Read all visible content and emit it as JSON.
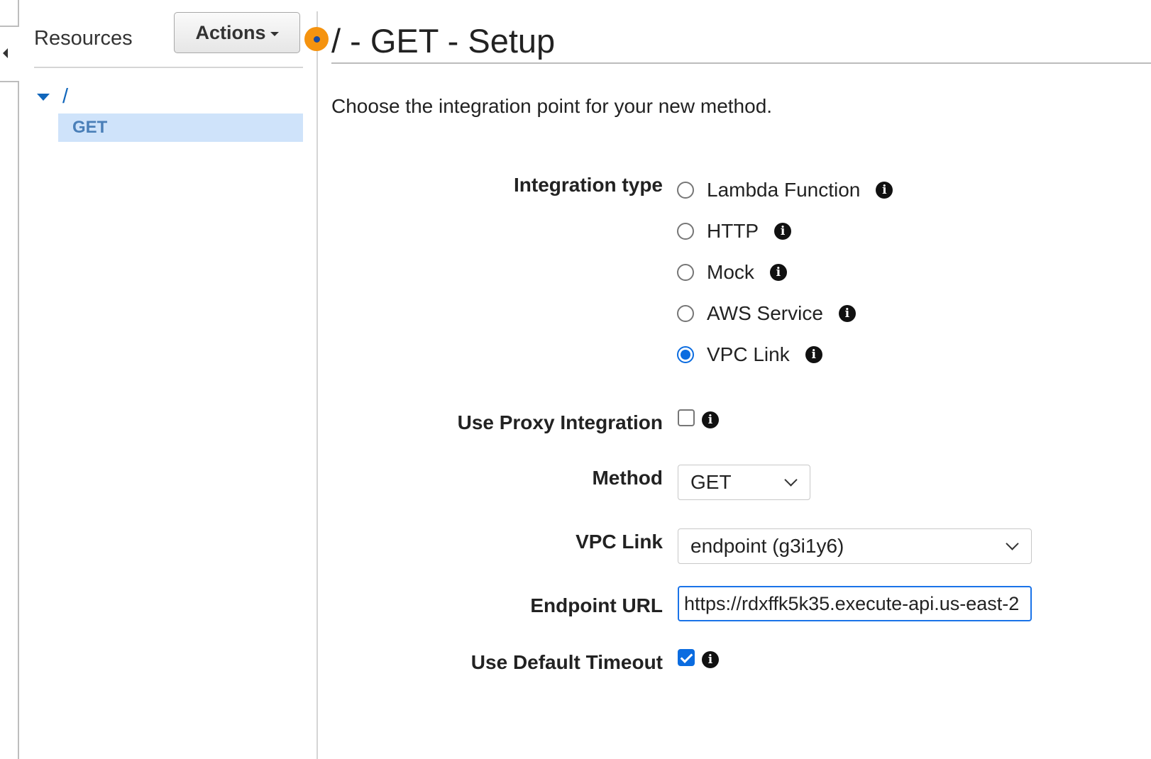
{
  "sidebar": {
    "title": "Resources",
    "actions_label": "Actions",
    "tree": {
      "root_path": "/",
      "selected_method": "GET"
    }
  },
  "main": {
    "title": "/ - GET - Setup",
    "intro": "Choose the integration point for your new method.",
    "integration_type": {
      "label": "Integration type",
      "options": [
        "Lambda Function",
        "HTTP",
        "Mock",
        "AWS Service",
        "VPC Link"
      ],
      "selected": "VPC Link"
    },
    "use_proxy_integration": {
      "label": "Use Proxy Integration",
      "checked": false
    },
    "method": {
      "label": "Method",
      "value": "GET"
    },
    "vpc_link": {
      "label": "VPC Link",
      "value": "endpoint (g3i1y6)"
    },
    "endpoint_url": {
      "label": "Endpoint URL",
      "value": "https://rdxffk5k35.execute-api.us-east-2"
    },
    "use_default_timeout": {
      "label": "Use Default Timeout",
      "checked": true
    }
  },
  "icons": {
    "info": "info-icon",
    "collapse": "collapse-arrow-icon",
    "tree_expand": "caret-down-icon"
  },
  "colors": {
    "accent": "#0b6ce0",
    "tree_link": "#1166bb",
    "selected_row": "#cfe3fa",
    "indicator": "#f5930f"
  }
}
